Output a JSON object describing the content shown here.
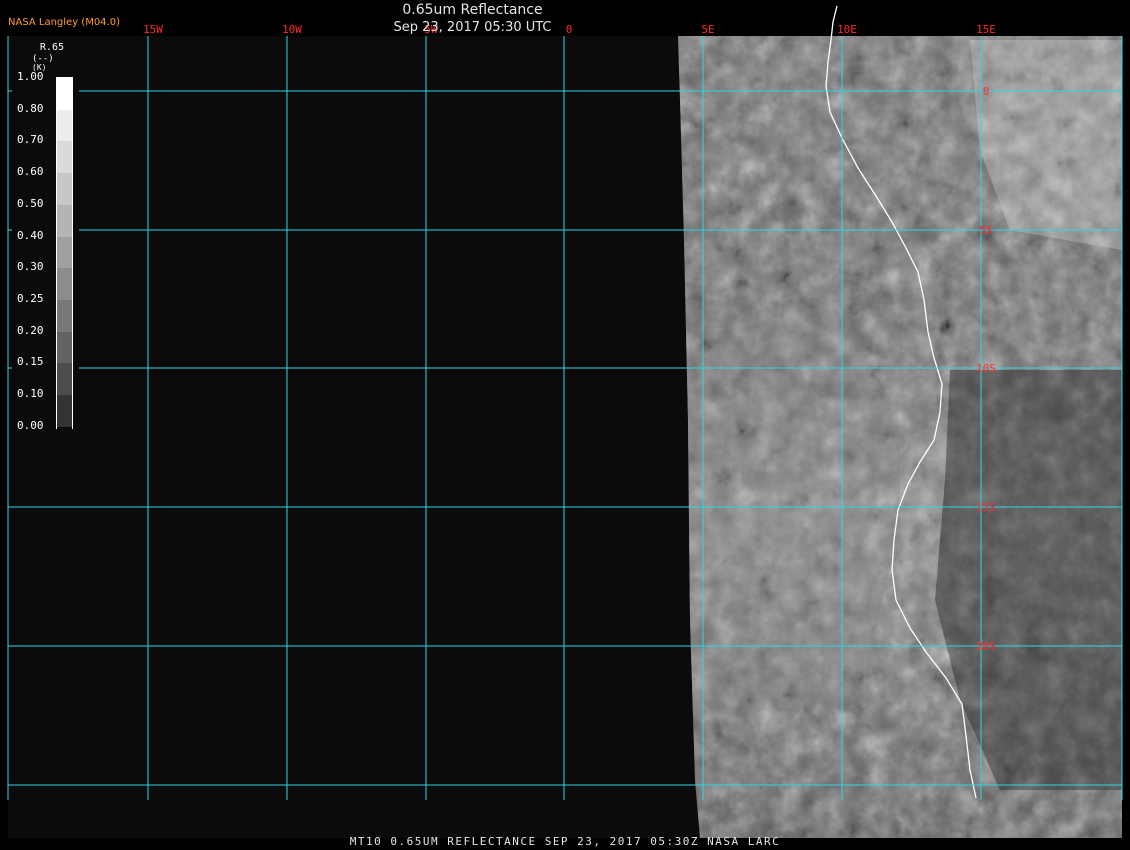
{
  "header": {
    "credit": "NASA Langley (M04.0)",
    "title": "0.65um Reflectance",
    "subtitle": "Sep 23, 2017 05:30 UTC"
  },
  "footer": {
    "caption": "MT10  0.65UM REFLECTANCE   SEP 23, 2017 05:30Z   NASA LARC"
  },
  "legend": {
    "title": "R.65",
    "unit": "(--)",
    "k_label": "(K)",
    "labels": [
      "1.00",
      "0.80",
      "0.70",
      "0.60",
      "0.50",
      "0.40",
      "0.30",
      "0.25",
      "0.20",
      "0.15",
      "0.10",
      "0.00"
    ],
    "colors": [
      "#ffffff",
      "#ededed",
      "#dadada",
      "#c7c7c7",
      "#b4b4b4",
      "#a0a0a0",
      "#8c8c8c",
      "#787878",
      "#636363",
      "#4d4d4d",
      "#333333",
      "#0a0a0a"
    ]
  },
  "grid": {
    "color": "#30d6e0",
    "label_color": "#ff2b2b",
    "lon_labels": [
      "15W",
      "10W",
      "5W",
      "0",
      "5E",
      "10E",
      "15E"
    ],
    "lat_labels": [
      "0",
      "5S",
      "10S",
      "15S",
      "20S"
    ]
  },
  "colors": {
    "background": "#000000",
    "space": "#0b0b0b",
    "coastline": "#ffffff"
  }
}
